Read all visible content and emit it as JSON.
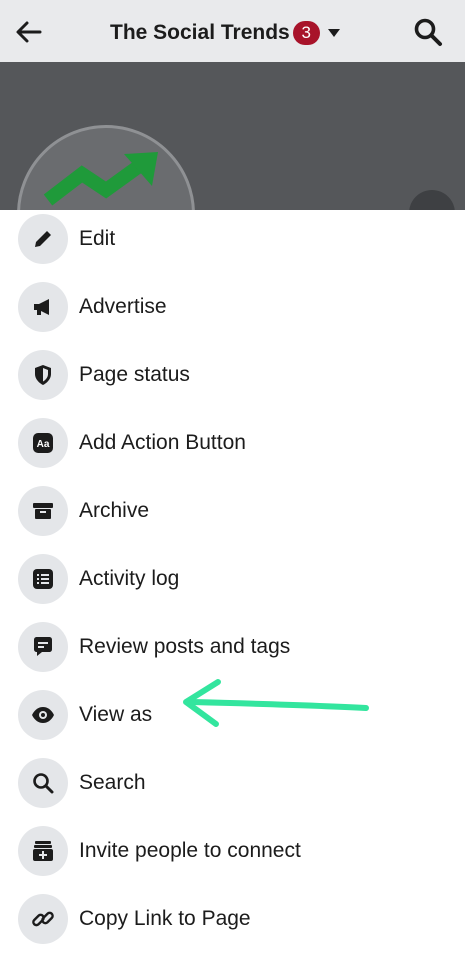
{
  "header": {
    "title": "The Social Trends",
    "badge_count": "3",
    "icons": [
      "back-arrow-icon",
      "caret-down-icon",
      "search-icon"
    ]
  },
  "colors": {
    "topbar": "#e9eaec",
    "cover": "#55575a",
    "badge": "#a8132a",
    "logo_arrow": "#1f9a3a",
    "annotation_arrow": "#33e59e",
    "icon_bg": "#e4e6e9"
  },
  "menu": {
    "items": [
      {
        "label": "Edit",
        "icon": "pencil-icon"
      },
      {
        "label": "Advertise",
        "icon": "megaphone-icon"
      },
      {
        "label": "Page status",
        "icon": "shield-icon"
      },
      {
        "label": "Add Action Button",
        "icon": "aa-icon"
      },
      {
        "label": "Archive",
        "icon": "archive-box-icon"
      },
      {
        "label": "Activity log",
        "icon": "list-icon"
      },
      {
        "label": "Review posts and tags",
        "icon": "chat-bubble-icon"
      },
      {
        "label": "View as",
        "icon": "eye-icon"
      },
      {
        "label": "Search",
        "icon": "search-icon"
      },
      {
        "label": "Invite people to connect",
        "icon": "invite-box-icon"
      },
      {
        "label": "Copy Link to Page",
        "icon": "link-icon"
      }
    ]
  },
  "annotation": {
    "points_to": "View as"
  }
}
